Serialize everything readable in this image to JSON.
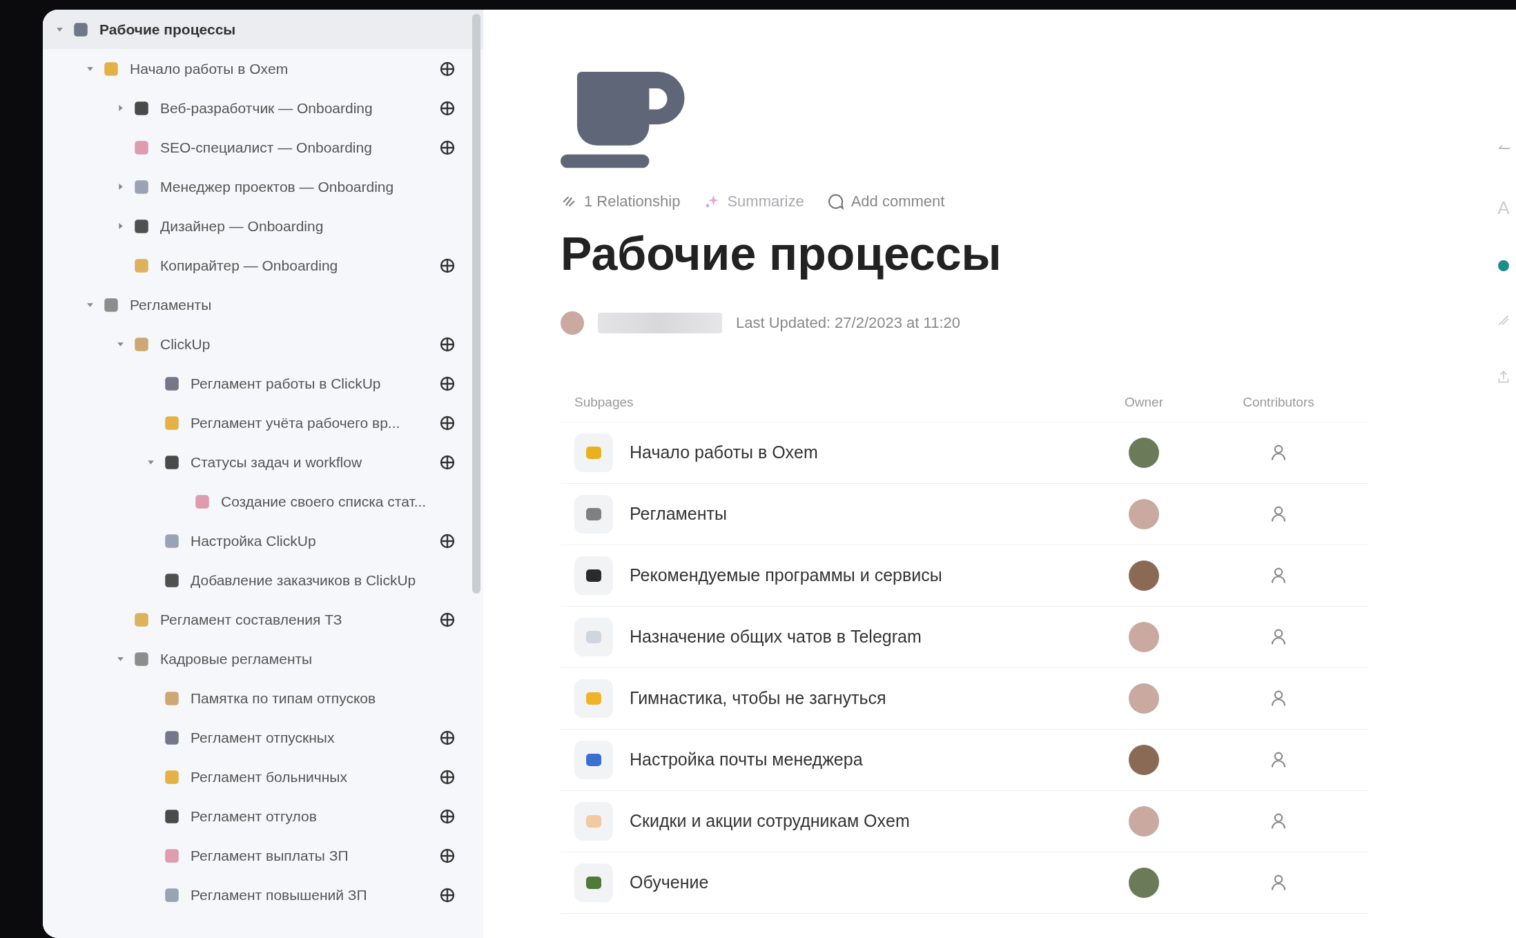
{
  "sidebar": {
    "tree": [
      {
        "label": "Рабочие процессы",
        "expanded": true,
        "shared": false,
        "selected": true,
        "children": [
          {
            "label": "Начало работы в Oxem",
            "expanded": true,
            "shared": true,
            "selected": false,
            "children": [
              {
                "label": "Веб-разработчик — Onboarding",
                "expanded": false,
                "shared": true,
                "selected": false
              },
              {
                "label": "SEO-специалист — Onboarding",
                "shared": true,
                "selected": false
              },
              {
                "label": "Менеджер проектов — Onboarding",
                "expanded": false,
                "shared": false,
                "selected": false
              },
              {
                "label": "Дизайнер — Onboarding",
                "expanded": false,
                "shared": false,
                "selected": false
              },
              {
                "label": "Копирайтер — Onboarding",
                "shared": true,
                "selected": false
              }
            ]
          },
          {
            "label": "Регламенты",
            "expanded": true,
            "shared": false,
            "selected": false,
            "children": [
              {
                "label": "ClickUp",
                "expanded": true,
                "shared": true,
                "selected": false,
                "children": [
                  {
                    "label": "Регламент работы в ClickUp",
                    "shared": true,
                    "selected": false
                  },
                  {
                    "label": "Регламент учёта рабочего вр...",
                    "shared": true,
                    "selected": false
                  },
                  {
                    "label": "Статусы задач и workflow",
                    "expanded": true,
                    "shared": true,
                    "selected": false,
                    "children": [
                      {
                        "label": "Создание своего списка стат...",
                        "shared": false,
                        "selected": false
                      }
                    ]
                  },
                  {
                    "label": "Настройка ClickUp",
                    "shared": true,
                    "selected": false
                  },
                  {
                    "label": "Добавление заказчиков в ClickUp",
                    "shared": false,
                    "selected": false
                  }
                ]
              },
              {
                "label": "Регламент составления ТЗ",
                "shared": true,
                "selected": false
              },
              {
                "label": "Кадровые регламенты",
                "expanded": true,
                "shared": false,
                "selected": false,
                "children": [
                  {
                    "label": "Памятка по типам отпусков",
                    "shared": false,
                    "selected": false
                  },
                  {
                    "label": "Регламент отпускных",
                    "shared": true,
                    "selected": false
                  },
                  {
                    "label": "Регламент больничных",
                    "shared": true,
                    "selected": false
                  },
                  {
                    "label": "Регламент отгулов",
                    "shared": true,
                    "selected": false
                  },
                  {
                    "label": "Регламент выплаты ЗП",
                    "shared": true,
                    "selected": false
                  },
                  {
                    "label": "Регламент повышений ЗП",
                    "shared": true,
                    "selected": false
                  }
                ]
              }
            ]
          }
        ]
      }
    ]
  },
  "page": {
    "actions": [
      {
        "kind": "relationship",
        "label": "1 Relationship",
        "disabled": false
      },
      {
        "kind": "summarize",
        "label": "Summarize",
        "disabled": true
      },
      {
        "kind": "comment",
        "label": "Add comment",
        "disabled": false
      }
    ],
    "title": "Рабочие процессы",
    "last_updated": "Last Updated: 27/2/2023 at 11:20"
  },
  "subpages": {
    "columns": [
      "Subpages",
      "Owner",
      "Contributors"
    ],
    "rows": [
      {
        "title": "Начало работы в Oxem"
      },
      {
        "title": "Регламенты"
      },
      {
        "title": "Рекомендуемые программы и сервисы"
      },
      {
        "title": "Назначение общих чатов в Telegram"
      },
      {
        "title": "Гимнастика, чтобы не загнуться"
      },
      {
        "title": "Настройка почты менеджера"
      },
      {
        "title": "Скидки и акции сотрудникам Oxem"
      },
      {
        "title": "Обучение"
      }
    ]
  },
  "right_rail": {
    "text": "A"
  }
}
